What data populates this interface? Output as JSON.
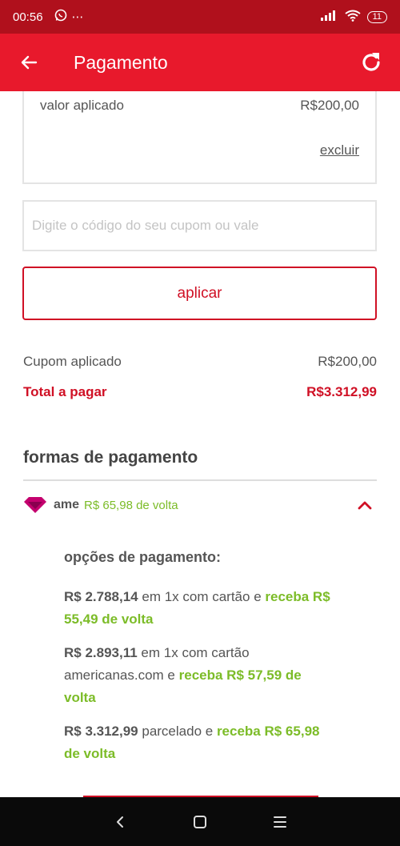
{
  "status_bar": {
    "time": "00:56",
    "battery": "11",
    "more": "⋯"
  },
  "header": {
    "title": "Pagamento"
  },
  "applied_coupon": {
    "label": "valor aplicado",
    "value": "R$200,00",
    "remove_label": "excluir"
  },
  "coupon": {
    "placeholder": "Digite o código do seu cupom ou vale",
    "apply_label": "aplicar"
  },
  "summary": {
    "coupon_label": "Cupom aplicado",
    "coupon_value": "R$200,00",
    "total_label": "Total a pagar",
    "total_value": "R$3.312,99"
  },
  "payment_methods": {
    "title": "formas de pagamento",
    "ame": {
      "name": "ame",
      "cashback": "R$ 65,98 de volta"
    },
    "options_title": "opções de pagamento:",
    "options": [
      {
        "price": "R$ 2.788,14",
        "text": " em 1x com cartão e ",
        "green": "receba R$ 55,49 de volta"
      },
      {
        "price": "R$ 2.893,11",
        "text": " em 1x com cartão americanas.com e ",
        "green": "receba R$ 57,59 de volta"
      },
      {
        "price": "R$ 3.312,99",
        "text": " parcelado e ",
        "green": "receba R$ 65,98 de volta"
      }
    ]
  },
  "colors": {
    "status_bar": "#b0101c",
    "app_bar": "#e8192c",
    "accent_red": "#d01025",
    "cashback_green": "#7cbc28",
    "ame_pink": "#c4006e"
  },
  "icons": {
    "back": "arrow-left",
    "refresh": "refresh",
    "ame": "ame-heart-logo",
    "expand": "chevron-up",
    "nav_back": "chevron-left",
    "nav_home": "square",
    "nav_menu": "menu-lines"
  }
}
